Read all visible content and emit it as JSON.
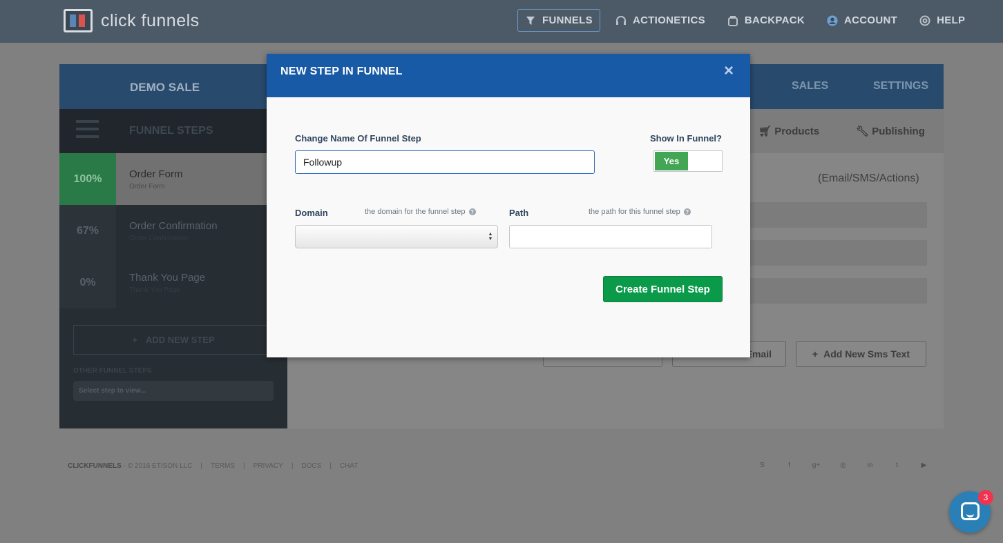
{
  "app": {
    "logo_text": "click funnels"
  },
  "nav": {
    "items": [
      {
        "label": "FUNNELS",
        "icon": "funnel-icon",
        "active": true
      },
      {
        "label": "ACTIONETICS",
        "icon": "headset-icon",
        "active": false
      },
      {
        "label": "BACKPACK",
        "icon": "backpack-icon",
        "active": false
      },
      {
        "label": "ACCOUNT",
        "icon": "user-icon",
        "active": false
      },
      {
        "label": "HELP",
        "icon": "lifebuoy-icon",
        "active": false
      }
    ]
  },
  "funnel": {
    "title": "DEMO SALE",
    "tabs": {
      "sales": "SALES",
      "settings": "SETTINGS"
    },
    "sub_tabs": {
      "products": "Products",
      "publishing": "Publishing"
    },
    "steps_label": "FUNNEL STEPS",
    "steps": [
      {
        "pct": "100%",
        "name": "Order Form",
        "sub": "Order Form"
      },
      {
        "pct": "67%",
        "name": "Order Confirmation",
        "sub": "Order Confirmation"
      },
      {
        "pct": "0%",
        "name": "Thank You Page",
        "sub": "Thank You Page"
      }
    ],
    "add_step_label": "ADD NEW STEP",
    "other_steps_label": "OTHER FUNNEL STEPS",
    "other_steps_placeholder": "Select step to view...",
    "followup_caption": "(Email/SMS/Actions)",
    "buttons": {
      "email": "Email",
      "sms": "Add New Sms Text"
    }
  },
  "footer": {
    "brand": "CLICKFUNNELS",
    "copyright": "- © 2016 ETISON LLC",
    "links": [
      "TERMS",
      "PRIVACY",
      "DOCS",
      "CHAT"
    ],
    "social": [
      "S",
      "f",
      "g+",
      "◎",
      "in",
      "t",
      "▶"
    ]
  },
  "modal": {
    "title": "NEW STEP IN FUNNEL",
    "close": "×",
    "name_label": "Change Name Of Funnel Step",
    "name_value": "Followup",
    "show_label": "Show In Funnel?",
    "show_value": "Yes",
    "domain_label": "Domain",
    "domain_hint": "the domain for the funnel step",
    "path_label": "Path",
    "path_hint": "the path for this funnel step",
    "path_value": "",
    "submit_label": "Create Funnel Step"
  },
  "chat": {
    "badge": "3"
  },
  "colors": {
    "modal_header": "#195aa6",
    "primary_button": "#0a9a4a",
    "toggle_on": "#42a654"
  }
}
